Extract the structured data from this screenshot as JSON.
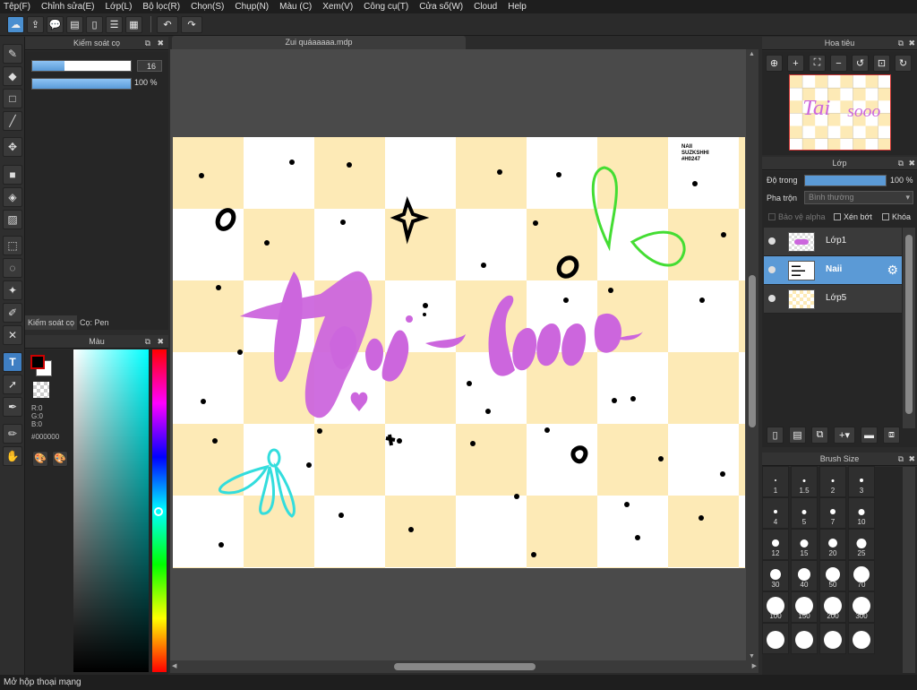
{
  "menu": [
    "Tệp(F)",
    "Chỉnh sửa(E)",
    "Lớp(L)",
    "Bộ lọc(R)",
    "Chọn(S)",
    "Chụp(N)",
    "Màu (C)",
    "Xem(V)",
    "Công cụ(T)",
    "Cửa số(W)",
    "Cloud",
    "Help"
  ],
  "toolbar": {
    "icons": [
      "cloud-icon",
      "share-icon",
      "speech-icon",
      "comment-icon",
      "page-icon",
      "list-icon",
      "grid-icon"
    ],
    "undo_icon": "undo-icon",
    "redo_icon": "redo-icon"
  },
  "brush_control": {
    "title": "Kiếm soát cọ",
    "size_value": "16",
    "size_fraction": 0.33,
    "opacity_value": "100 %",
    "opacity_fraction": 1.0
  },
  "tabs": {
    "brush_control": "Kiếm soát cọ",
    "brush": "Cọ: Pen"
  },
  "color_panel": {
    "title": "Màu",
    "r": "R:0",
    "g": "G:0",
    "b": "B:0",
    "hex": "#000000",
    "primary": "#000000",
    "secondary": "#ffffff"
  },
  "document": {
    "tab": "Zui quáaaaaa.mdp"
  },
  "navigator": {
    "title": "Hoa tiêu"
  },
  "layers": {
    "title": "Lớp",
    "opacity_label": "Độ trong",
    "opacity_value": "100 %",
    "blend_label": "Pha trộn",
    "blend_value": "Bình thường",
    "protect_alpha": "Bảo vệ alpha",
    "clipping": "Xén bớt",
    "lock": "Khóa",
    "items": [
      {
        "name": "Lớp1"
      },
      {
        "name": "Naii"
      },
      {
        "name": "Lớp5"
      }
    ]
  },
  "brush_size": {
    "title": "Brush Size",
    "sizes": [
      "1",
      "1.5",
      "2",
      "3",
      "4",
      "5",
      "7",
      "10",
      "12",
      "15",
      "20",
      "25",
      "30",
      "40",
      "50",
      "70",
      "100",
      "150",
      "200",
      "300",
      "",
      "",
      "",
      ""
    ]
  },
  "status": "Mở hộp thoại mạng",
  "canvas_text": {
    "signature": "NAII\nSUZKSHHI\n#H0247"
  },
  "colors": {
    "accent": "#5b9ad6",
    "purple_text": "#cc66dd",
    "checker_yellow": "#fdeab6",
    "green": "#44dd33",
    "cyan": "#33dddd"
  }
}
